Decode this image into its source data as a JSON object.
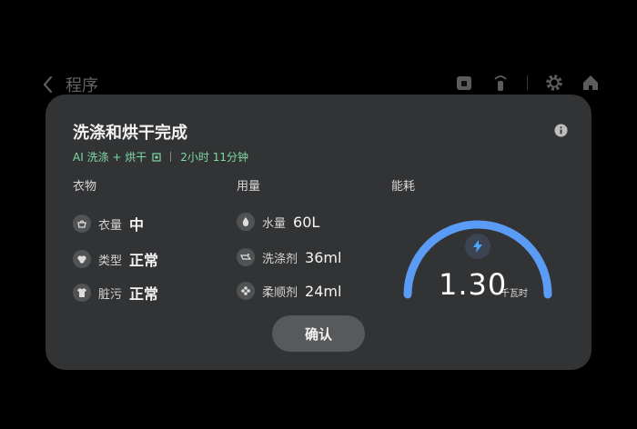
{
  "header": {
    "title": "程序",
    "icons": [
      "back-chevron-icon",
      "child-lock-icon",
      "remote-control-icon",
      "gear-icon",
      "home-icon"
    ]
  },
  "modal": {
    "title": "洗涤和烘干完成",
    "subtitle": {
      "mode": "AI 洗涤 + 烘干",
      "duration": "2小时 11分钟"
    },
    "clothes": {
      "heading": "衣物",
      "items": [
        {
          "label": "衣量",
          "value": "中"
        },
        {
          "label": "类型",
          "value": "正常"
        },
        {
          "label": "脏污",
          "value": "正常"
        }
      ]
    },
    "usage": {
      "heading": "用量",
      "items": [
        {
          "label": "水量",
          "value": "60L"
        },
        {
          "label": "洗涤剂",
          "value": "36ml"
        },
        {
          "label": "柔顺剂",
          "value": "24ml"
        }
      ]
    },
    "energy": {
      "heading": "能耗",
      "value": "1.30",
      "unit": "千瓦时"
    },
    "confirm_label": "确认"
  },
  "colors": {
    "accent_green": "#7ed9a4",
    "gauge_blue": "#5a9cf5",
    "modal_bg": "#323335"
  }
}
